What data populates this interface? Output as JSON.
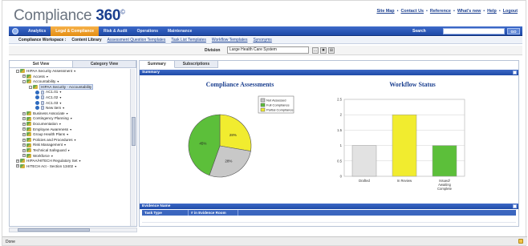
{
  "app": {
    "logo_text": "Compliance",
    "logo_num": "360",
    "logo_mark": "©"
  },
  "toplinks": [
    "Site Map",
    "Contact Us",
    "Reference",
    "What's new",
    "Help",
    "Logout"
  ],
  "toplinks_sep": "•",
  "nav": {
    "tabs": [
      "Analytics",
      "Legal & Compliance",
      "Risk & Audit",
      "Operations",
      "Maintenance"
    ],
    "active_index": 1,
    "search_label": "Search",
    "search_value": "",
    "go_label": "GO"
  },
  "subnav": {
    "workspace": "Compliance Workspace :",
    "current": "Content Library",
    "links": [
      "Assessment Question Templates",
      "Task List Templates",
      "Workflow Templates",
      "Synonyms"
    ]
  },
  "division": {
    "label": "Division",
    "value": "Large Health Care System",
    "buttons": [
      "...",
      "✖",
      "⊞"
    ]
  },
  "left": {
    "tabs": [
      "Set View",
      "Category View"
    ],
    "active_tab": 0,
    "tree": [
      {
        "label": "HIPAA Security Assessment",
        "indent": 1,
        "icon": "folder",
        "exp": "-",
        "arrow": true
      },
      {
        "label": "Access",
        "indent": 2,
        "icon": "folder",
        "exp": "+",
        "arrow": true
      },
      {
        "label": "Accountability",
        "indent": 2,
        "icon": "folder",
        "exp": "-",
        "arrow": true
      },
      {
        "label": "HIPAA Security - Accountability",
        "indent": 3,
        "icon": "folder",
        "exp": "-",
        "arrow": false,
        "selected": true
      },
      {
        "label": "AC1.01",
        "indent": 4,
        "icon": "q",
        "arrow": true
      },
      {
        "label": "AC1.02",
        "indent": 4,
        "icon": "q",
        "arrow": true
      },
      {
        "label": "AC1.03",
        "indent": 4,
        "icon": "q",
        "arrow": true
      },
      {
        "label": "New item",
        "indent": 4,
        "icon": "q",
        "arrow": true
      },
      {
        "label": "Business Associate",
        "indent": 2,
        "icon": "folder",
        "exp": "+",
        "arrow": true
      },
      {
        "label": "Contingency Planning",
        "indent": 2,
        "icon": "folder",
        "exp": "+",
        "arrow": true
      },
      {
        "label": "Documentation",
        "indent": 2,
        "icon": "folder",
        "exp": "+",
        "arrow": true
      },
      {
        "label": "Employee Awareness",
        "indent": 2,
        "icon": "folder",
        "exp": "+",
        "arrow": true
      },
      {
        "label": "Group Health Plans",
        "indent": 2,
        "icon": "folder",
        "exp": "+",
        "arrow": true
      },
      {
        "label": "Policies and Procedures",
        "indent": 2,
        "icon": "folder",
        "exp": "+",
        "arrow": true
      },
      {
        "label": "Risk Management",
        "indent": 2,
        "icon": "folder",
        "exp": "+",
        "arrow": true
      },
      {
        "label": "Technical Safeguard",
        "indent": 2,
        "icon": "folder",
        "exp": "+",
        "arrow": true
      },
      {
        "label": "Workforce",
        "indent": 2,
        "icon": "folder",
        "exp": "+",
        "arrow": true
      },
      {
        "label": "HIPAA/HITECH Regulatory Set",
        "indent": 1,
        "icon": "folder",
        "exp": "+",
        "arrow": true
      },
      {
        "label": "HITECH Act - Section 13402",
        "indent": 1,
        "icon": "folder",
        "exp": "+",
        "arrow": true
      }
    ]
  },
  "right": {
    "tabs": [
      "Summary",
      "Subscriptions"
    ],
    "active_tab": 0,
    "summary_title": "Summary",
    "evidence_title": "Evidence Name",
    "evidence_columns": [
      "Task Type",
      "# in Evidence Room"
    ]
  },
  "chart_data": [
    {
      "type": "pie",
      "title": "Compliance Assessments",
      "labels": [
        "Not Assessed",
        "Full Compliance",
        "Partial Compliance"
      ],
      "values": [
        28,
        45,
        28
      ],
      "data_labels": [
        "28%",
        "45%",
        "28%"
      ],
      "colors": [
        "#c8c8c8",
        "#5cbf3a",
        "#f1ec2f"
      ],
      "legend": "top-right"
    },
    {
      "type": "bar",
      "title": "Workflow Status",
      "categories": [
        "Drafted",
        "In Review",
        "Issued/ Awaiting Complete"
      ],
      "values": [
        1,
        2,
        1
      ],
      "colors": [
        "#e2e2e2",
        "#f1ec2f",
        "#5cbf3a"
      ],
      "ylim": [
        0,
        2.5
      ],
      "yticks": [
        "0",
        "0.5",
        "1",
        "1.5",
        "2",
        "2.5"
      ],
      "grid": true
    }
  ],
  "status": {
    "text": "Done"
  }
}
